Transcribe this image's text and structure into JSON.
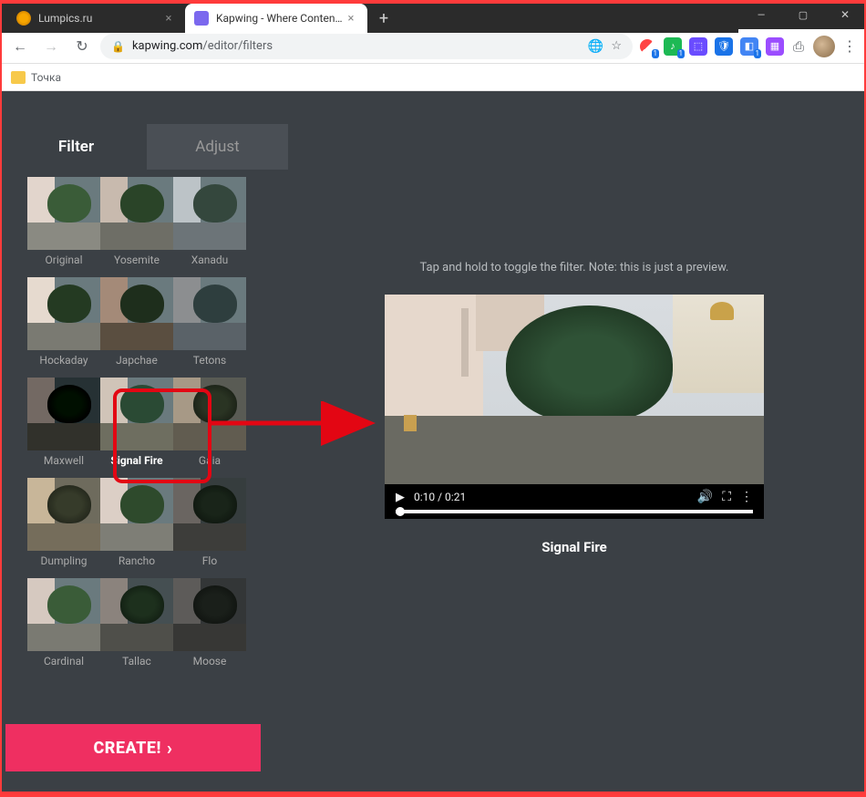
{
  "window": {
    "min": "",
    "max": "",
    "close": ""
  },
  "tabs": [
    {
      "title": "Lumpics.ru",
      "active": false
    },
    {
      "title": "Kapwing - Where Content Creati...",
      "active": true
    }
  ],
  "newtab_label": "+",
  "toolbar": {
    "back": "←",
    "forward": "→",
    "reload": "↻",
    "url_domain": "kapwing.com",
    "url_path": "/editor/filters",
    "translate": "⎋",
    "star": "☆"
  },
  "bookmarks": {
    "folder_label": "Точка"
  },
  "sidebar": {
    "tabs": {
      "filter": "Filter",
      "adjust": "Adjust"
    },
    "filters": [
      [
        {
          "name": "Original",
          "cls": "f-original"
        },
        {
          "name": "Yosemite",
          "cls": "f-yosemite"
        },
        {
          "name": "Xanadu",
          "cls": "f-xanadu"
        }
      ],
      [
        {
          "name": "Hockaday",
          "cls": "f-hockaday"
        },
        {
          "name": "Japchae",
          "cls": "f-japchae"
        },
        {
          "name": "Tetons",
          "cls": "f-tetons"
        }
      ],
      [
        {
          "name": "Maxwell",
          "cls": "f-maxwell"
        },
        {
          "name": "Signal Fire",
          "cls": "f-signalfire",
          "selected": true
        },
        {
          "name": "Gaia",
          "cls": "f-gaia"
        }
      ],
      [
        {
          "name": "Dumpling",
          "cls": "f-dumpling"
        },
        {
          "name": "Rancho",
          "cls": "f-rancho"
        },
        {
          "name": "Flo",
          "cls": "f-flo"
        }
      ],
      [
        {
          "name": "Cardinal",
          "cls": "f-cardinal"
        },
        {
          "name": "Tallac",
          "cls": "f-tallac"
        },
        {
          "name": "Moose",
          "cls": "f-moose"
        }
      ]
    ],
    "create_label": "CREATE!"
  },
  "preview": {
    "hint": "Tap and hold to toggle the filter. Note: this is just a preview.",
    "time": "0:10 / 0:21",
    "selected_name": "Signal Fire"
  }
}
